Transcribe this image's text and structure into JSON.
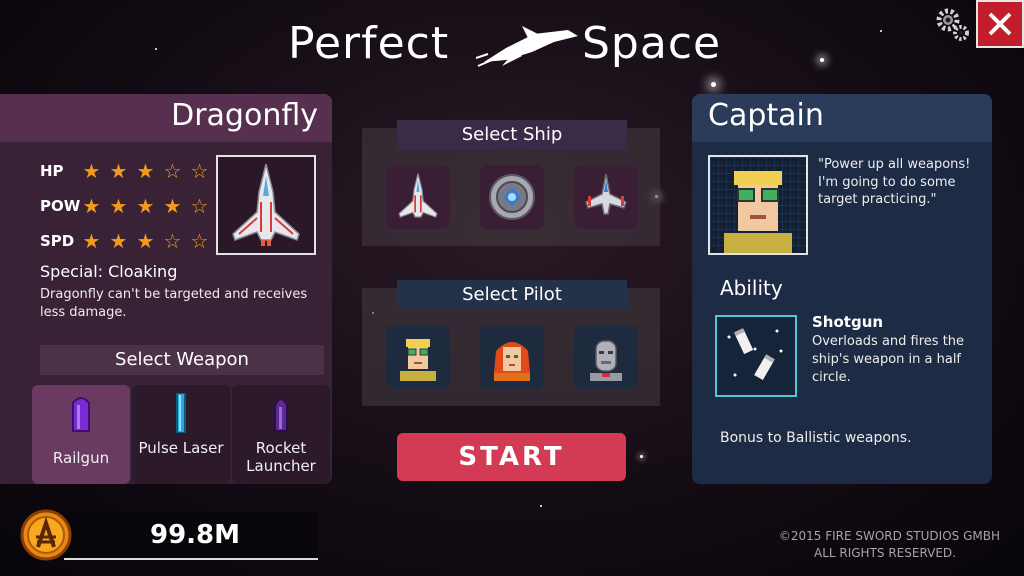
{
  "header": {
    "title_left": "Perfect",
    "title_right": "Space",
    "settings_icon": "gears-icon",
    "close_icon": "close-icon"
  },
  "ship": {
    "name": "Dragonfly",
    "stats": [
      {
        "label": "HP",
        "rating": 3,
        "max": 5
      },
      {
        "label": "POW",
        "rating": 4,
        "max": 5
      },
      {
        "label": "SPD",
        "rating": 3,
        "max": 5
      }
    ],
    "special": "Special: Cloaking",
    "special_desc": "Dragonfly can't be targeted and receives less damage."
  },
  "weapons": {
    "header": "Select Weapon",
    "items": [
      {
        "label": "Railgun",
        "selected": true
      },
      {
        "label": "Pulse Laser",
        "selected": false
      },
      {
        "label": "Rocket Launcher",
        "selected": false
      }
    ]
  },
  "currency": {
    "amount": "99.8M",
    "icon": "coin-icon"
  },
  "select_ship": {
    "title": "Select Ship",
    "items": [
      "ship-dragonfly-icon",
      "ship-saucer-icon",
      "ship-fighter-icon"
    ]
  },
  "select_pilot": {
    "title": "Select Pilot",
    "items": [
      "pilot-captain-icon",
      "pilot-redhead-icon",
      "pilot-robot-icon"
    ]
  },
  "start_label": "START",
  "captain": {
    "title": "Captain",
    "quote": "\"Power up all weapons!\nI'm going to do some target practicing.\"",
    "ability_title": "Ability",
    "ability_name": "Shotgun",
    "ability_desc": "Overloads and fires the ship's weapon in a half circle.",
    "bonus": "Bonus to Ballistic weapons."
  },
  "copyright": {
    "line1": "©2015 FIRE SWORD STUDIOS GMBH",
    "line2": "ALL RIGHTS RESERVED."
  },
  "colors": {
    "accent_red": "#c21d2a",
    "start_button": "#d33b55",
    "star_orange": "#f39a1c",
    "ability_border": "#4fc7d4"
  }
}
